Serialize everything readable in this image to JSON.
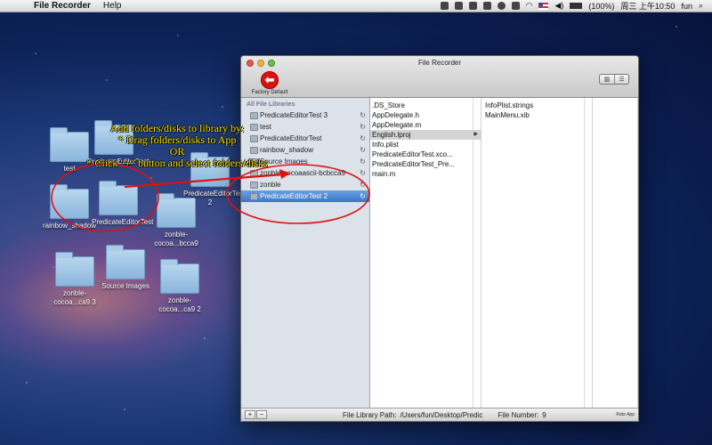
{
  "menubar": {
    "app_name": "File Recorder",
    "help": "Help",
    "battery": "(100%)",
    "clock": "周三 上午10:50",
    "user": "fun"
  },
  "desktop": {
    "folders": [
      {
        "label": "test"
      },
      {
        "label": "PredicateEditorTest"
      },
      {
        "label": "rainbow_shadow"
      },
      {
        "label": "PredicateEditorTest"
      },
      {
        "label": "PredicateEditorTest 2"
      },
      {
        "label": "zonble-cocoa...bcca9"
      },
      {
        "label": "zonble-cocoa...ca9 3"
      },
      {
        "label": "Source Images"
      },
      {
        "label": "zonble-cocoa...ca9 2"
      }
    ]
  },
  "annotation": {
    "line1": "Add folders/disks to library by:",
    "line2": "* Drag folders/disks to App",
    "line3": "OR",
    "line4": "* Click \"+\" button and select folders/disks",
    "color": "#ffe600"
  },
  "window": {
    "title": "File Recorder",
    "toolbar": {
      "factory_default_label": "Factory Default"
    },
    "sidebar": {
      "header": "All File Libraries",
      "items": [
        {
          "label": "PredicateEditorTest 3"
        },
        {
          "label": "test"
        },
        {
          "label": "PredicateEditorTest"
        },
        {
          "label": "rainbow_shadow"
        },
        {
          "label": "Source Images"
        },
        {
          "label": "zonble-cocoaascii-bcbcca9"
        },
        {
          "label": "zonble"
        },
        {
          "label": "PredicateEditorTest 2"
        }
      ],
      "selected_index": 7
    },
    "column1": {
      "items": [
        ".DS_Store",
        "AppDelegate.h",
        "AppDelegate.m",
        "English.lproj",
        "Info.plist",
        "PredicateEditorTest.xco...",
        "PredicateEditorTest_Pre...",
        "main.m"
      ],
      "highlighted_index": 3
    },
    "column2": {
      "items": [
        "InfoPlist.strings",
        "MainMenu.xib"
      ]
    },
    "bottombar": {
      "add_label": "+",
      "remove_label": "−",
      "path_label": "File Library Path:",
      "path_value": "/Users/fun/Desktop/Predic",
      "file_number_label": "File Number:",
      "file_number_value": "9",
      "rate_label": "Rate App"
    }
  }
}
